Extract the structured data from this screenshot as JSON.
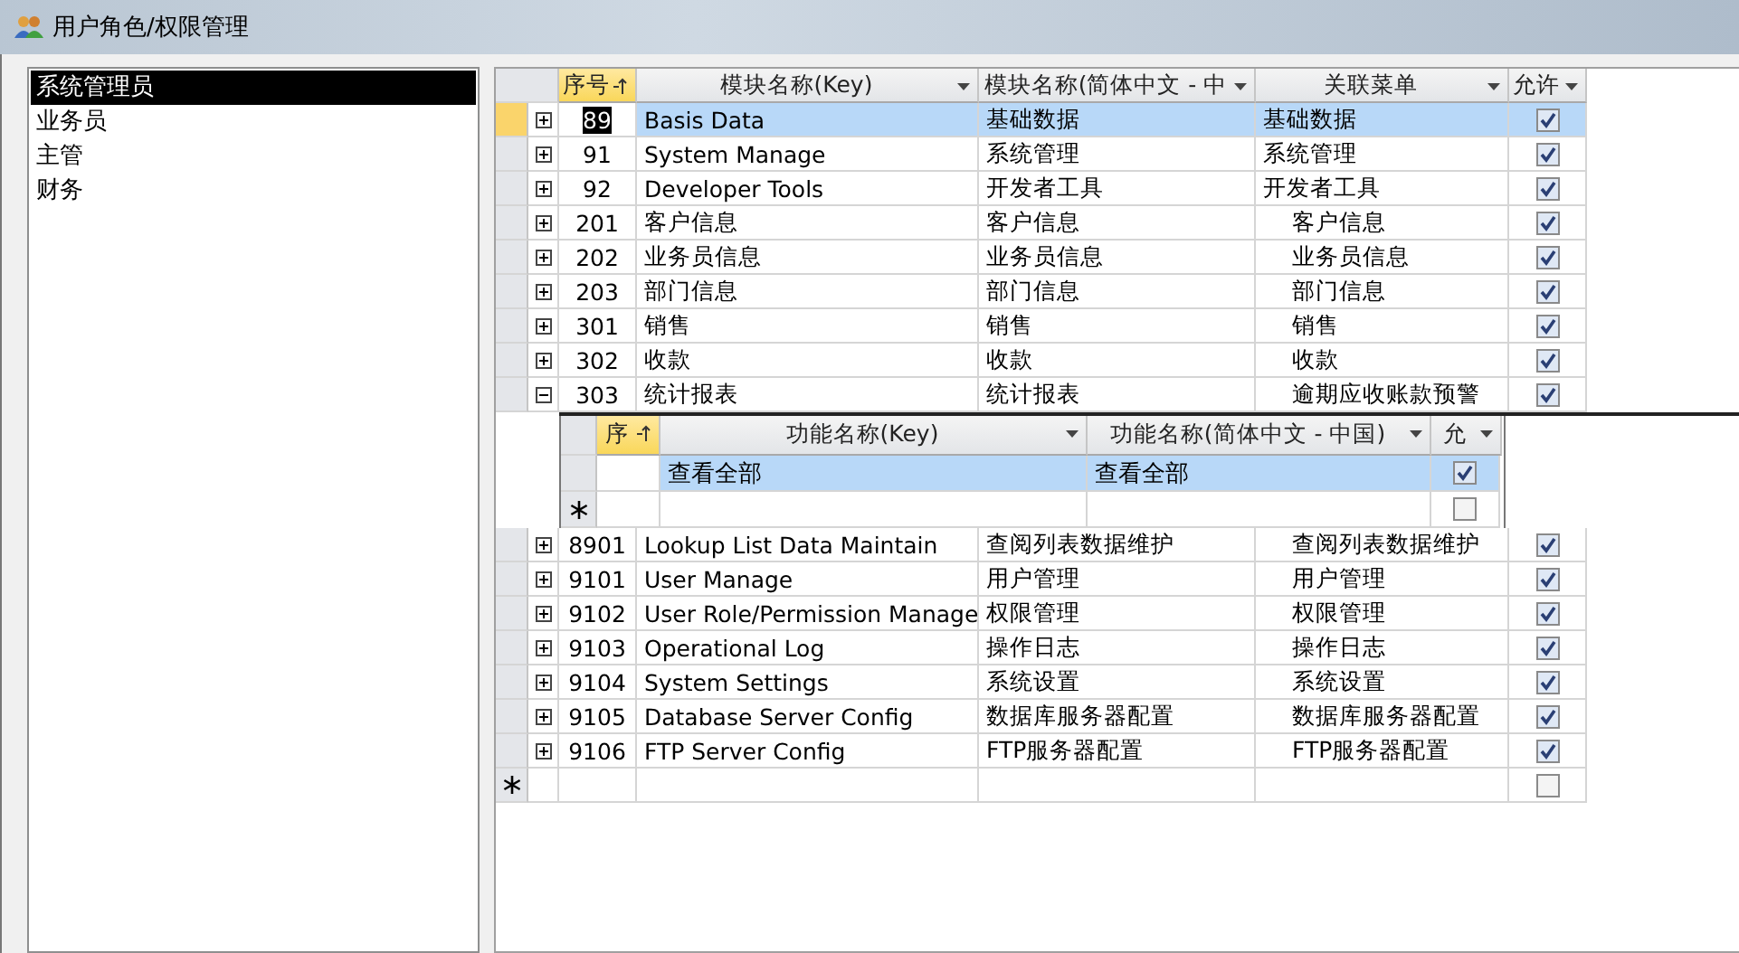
{
  "window": {
    "title": "用户角色/权限管理"
  },
  "roles": [
    {
      "label": "系统管理员",
      "selected": true
    },
    {
      "label": "业务员",
      "selected": false
    },
    {
      "label": "主管",
      "selected": false
    },
    {
      "label": "财务",
      "selected": false
    }
  ],
  "grid": {
    "columns": [
      {
        "label": "序号",
        "sorted": true
      },
      {
        "label": "模块名称(Key)",
        "sorted": false
      },
      {
        "label": "模块名称(简体中文 - 中",
        "sorted": false
      },
      {
        "label": "关联菜单",
        "sorted": false
      },
      {
        "label": "允许",
        "sorted": false
      }
    ],
    "rows": [
      {
        "id": "89",
        "key": "Basis Data",
        "name": "基础数据",
        "menu": "基础数据",
        "menu_indented": false,
        "allowed": true,
        "expanded": false,
        "selected": true
      },
      {
        "id": "91",
        "key": "System Manage",
        "name": "系统管理",
        "menu": "系统管理",
        "menu_indented": false,
        "allowed": true,
        "expanded": false,
        "selected": false
      },
      {
        "id": "92",
        "key": "Developer Tools",
        "name": "开发者工具",
        "menu": "开发者工具",
        "menu_indented": false,
        "allowed": true,
        "expanded": false,
        "selected": false
      },
      {
        "id": "201",
        "key": "客户信息",
        "name": "客户信息",
        "menu": "客户信息",
        "menu_indented": true,
        "allowed": true,
        "expanded": false,
        "selected": false
      },
      {
        "id": "202",
        "key": "业务员信息",
        "name": "业务员信息",
        "menu": "业务员信息",
        "menu_indented": true,
        "allowed": true,
        "expanded": false,
        "selected": false
      },
      {
        "id": "203",
        "key": "部门信息",
        "name": "部门信息",
        "menu": "部门信息",
        "menu_indented": true,
        "allowed": true,
        "expanded": false,
        "selected": false
      },
      {
        "id": "301",
        "key": "销售",
        "name": "销售",
        "menu": "销售",
        "menu_indented": true,
        "allowed": true,
        "expanded": false,
        "selected": false
      },
      {
        "id": "302",
        "key": "收款",
        "name": "收款",
        "menu": "收款",
        "menu_indented": true,
        "allowed": true,
        "expanded": false,
        "selected": false
      },
      {
        "id": "303",
        "key": "统计报表",
        "name": "统计报表",
        "menu": "逾期应收账款预警",
        "menu_indented": true,
        "allowed": true,
        "expanded": true,
        "selected": false,
        "subgrid": {
          "columns": [
            {
              "label": "序",
              "sorted": true
            },
            {
              "label": "功能名称(Key)",
              "sorted": false
            },
            {
              "label": "功能名称(简体中文 - 中国)",
              "sorted": false
            },
            {
              "label": "允",
              "sorted": false
            }
          ],
          "rows": [
            {
              "key": "查看全部",
              "name": "查看全部",
              "allowed": true,
              "selected": true
            }
          ],
          "new_row": {
            "allowed": false
          }
        }
      },
      {
        "id": "8901",
        "key": "Lookup List Data Maintain",
        "name": "查阅列表数据维护",
        "menu": "查阅列表数据维护",
        "menu_indented": true,
        "allowed": true,
        "expanded": false,
        "selected": false
      },
      {
        "id": "9101",
        "key": "User Manage",
        "name": "用户管理",
        "menu": "用户管理",
        "menu_indented": true,
        "allowed": true,
        "expanded": false,
        "selected": false
      },
      {
        "id": "9102",
        "key": "User Role/Permission Manage",
        "name": "权限管理",
        "menu": "权限管理",
        "menu_indented": true,
        "allowed": true,
        "expanded": false,
        "selected": false
      },
      {
        "id": "9103",
        "key": "Operational Log",
        "name": "操作日志",
        "menu": "操作日志",
        "menu_indented": true,
        "allowed": true,
        "expanded": false,
        "selected": false
      },
      {
        "id": "9104",
        "key": "System Settings",
        "name": "系统设置",
        "menu": "系统设置",
        "menu_indented": true,
        "allowed": true,
        "expanded": false,
        "selected": false
      },
      {
        "id": "9105",
        "key": "Database Server Config",
        "name": "数据库服务器配置",
        "menu": "数据库服务器配置",
        "menu_indented": true,
        "allowed": true,
        "expanded": false,
        "selected": false
      },
      {
        "id": "9106",
        "key": "FTP Server Config",
        "name": "FTP服务器配置",
        "menu": "FTP服务器配置",
        "menu_indented": true,
        "allowed": true,
        "expanded": false,
        "selected": false
      }
    ],
    "new_row": {
      "allowed": false
    }
  }
}
